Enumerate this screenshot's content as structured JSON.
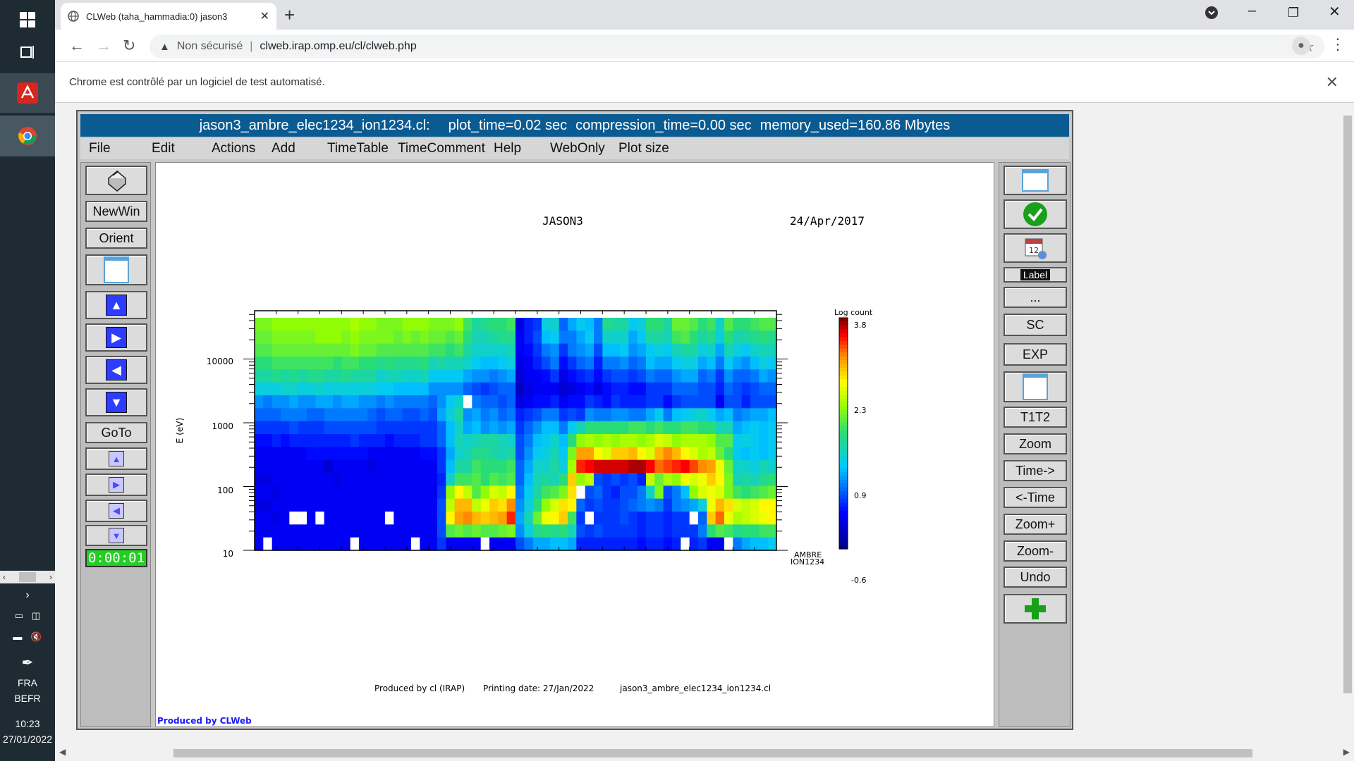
{
  "taskbar": {
    "clock_time": "10:23",
    "clock_date": "27/01/2022",
    "language": "FRA",
    "layout": "BEFR"
  },
  "browser": {
    "tab_title": "CLWeb (taha_hammadia:0) jason3",
    "security_label": "Non sécurisé",
    "url": "clweb.irap.omp.eu/cl/clweb.php",
    "infobar_text": "Chrome est contrôlé par un logiciel de test automatisé."
  },
  "clweb": {
    "title_file": "jason3_ambre_elec1234_ion1234.cl:",
    "title_plot_time": "plot_time=0.02 sec",
    "title_compression": "compression_time=0.00 sec",
    "title_memory": "memory_used=160.86 Mbytes",
    "menu": [
      "File",
      "Edit",
      "Actions",
      "Add",
      "TimeTable",
      "TimeComment",
      "Help",
      "WebOnly",
      "Plot size"
    ],
    "left_buttons": {
      "newwin": "NewWin",
      "orient": "Orient",
      "goto": "GoTo",
      "timer": "0:00:01"
    },
    "right_buttons": {
      "label": "Label",
      "more": "...",
      "sc": "SC",
      "exp": "EXP",
      "t1t2": "T1T2",
      "zoom": "Zoom",
      "time_fwd": "Time->",
      "time_back": "<-Time",
      "zoom_plus": "Zoom+",
      "zoom_minus": "Zoom-",
      "undo": "Undo"
    },
    "footer_left": "Produced by CLWeb"
  },
  "chart_data": {
    "type": "heatmap",
    "title": "JASON3",
    "date": "24/Apr/2017",
    "ylabel": "E (eV)",
    "yscale": "log",
    "yticks": [
      "10000",
      "1000",
      "100",
      "10"
    ],
    "panel_label_1": "AMBRE",
    "panel_label_2": "ION1234",
    "colorbar_title": "Log count",
    "colorbar_ticks": [
      "3.8",
      "2.3",
      "0.9",
      "-0.6"
    ],
    "colorbar_range": [
      -0.6,
      3.8
    ],
    "footer": {
      "produced_by": "Produced by cl (IRAP)",
      "printing_date": "Printing date: 27/Jan/2022",
      "filename": "jason3_ambre_elec1234_ion1234.cl"
    },
    "grid": {
      "cols": 60,
      "rows": 18,
      "note_rows_top_to_bottom": true,
      "values": [
        [
          2.0,
          2.0,
          2.1,
          2.1,
          2.1,
          2.1,
          2.1,
          2.1,
          2.1,
          2.1,
          2.1,
          2.2,
          2.1,
          2.1,
          2.0,
          2.0,
          2.0,
          2.1,
          2.1,
          2.1,
          2.0,
          2.0,
          2.0,
          2.1,
          1.7,
          1.4,
          1.5,
          1.6,
          1.6,
          1.7,
          -0.1,
          0.2,
          0.3,
          1.1,
          1.2,
          0.5,
          0.8,
          1.0,
          0.9,
          0.6,
          1.5,
          1.4,
          1.4,
          1.0,
          1.1,
          1.6,
          1.6,
          1.4,
          1.9,
          1.9,
          1.8,
          1.6,
          1.7,
          1.2,
          1.8,
          1.6,
          1.6,
          1.7,
          1.8,
          1.8
        ],
        [
          1.9,
          1.9,
          2.0,
          2.0,
          2.0,
          2.0,
          2.0,
          2.1,
          2.1,
          2.1,
          2.0,
          2.1,
          2.0,
          2.0,
          2.0,
          2.0,
          1.9,
          2.0,
          1.9,
          2.0,
          1.9,
          1.9,
          1.8,
          1.9,
          1.6,
          1.3,
          1.3,
          1.4,
          1.5,
          1.5,
          0.0,
          0.2,
          0.4,
          0.9,
          1.0,
          0.6,
          0.6,
          0.8,
          1.0,
          0.6,
          1.2,
          1.2,
          1.2,
          0.8,
          1.0,
          1.4,
          1.4,
          1.3,
          1.7,
          1.8,
          1.6,
          1.4,
          1.5,
          1.1,
          1.6,
          1.3,
          1.4,
          1.5,
          1.6,
          1.5
        ],
        [
          1.8,
          1.8,
          1.9,
          1.9,
          1.9,
          1.9,
          1.9,
          1.9,
          1.9,
          1.9,
          1.9,
          2.0,
          1.9,
          1.9,
          1.8,
          1.8,
          1.8,
          1.8,
          1.8,
          1.8,
          1.7,
          1.7,
          1.6,
          1.7,
          1.4,
          1.2,
          1.2,
          1.2,
          1.2,
          1.3,
          0.0,
          0.1,
          0.3,
          0.6,
          0.7,
          0.3,
          0.6,
          0.7,
          0.8,
          0.4,
          0.9,
          0.9,
          1.0,
          0.7,
          0.8,
          1.0,
          1.1,
          1.0,
          1.3,
          1.4,
          1.4,
          1.1,
          1.2,
          0.8,
          1.3,
          1.1,
          1.0,
          1.2,
          1.3,
          1.3
        ],
        [
          1.6,
          1.6,
          1.7,
          1.7,
          1.7,
          1.7,
          1.7,
          1.7,
          1.7,
          1.6,
          1.7,
          1.7,
          1.6,
          1.6,
          1.5,
          1.6,
          1.5,
          1.5,
          1.5,
          1.6,
          1.3,
          1.4,
          1.3,
          1.3,
          1.2,
          1.0,
          0.9,
          0.9,
          1.0,
          1.1,
          -0.1,
          0.0,
          0.2,
          0.4,
          0.6,
          0.1,
          0.3,
          0.5,
          0.6,
          0.2,
          0.6,
          0.6,
          0.7,
          0.5,
          0.6,
          0.9,
          0.8,
          0.8,
          1.0,
          1.1,
          1.1,
          0.8,
          0.9,
          0.6,
          1.0,
          0.8,
          0.7,
          0.9,
          1.1,
          1.0
        ],
        [
          1.4,
          1.4,
          1.5,
          1.4,
          1.5,
          1.4,
          1.5,
          1.5,
          1.4,
          1.4,
          1.5,
          1.4,
          1.4,
          1.4,
          1.2,
          1.3,
          1.3,
          1.2,
          1.2,
          1.3,
          1.0,
          1.0,
          1.0,
          1.0,
          0.8,
          0.7,
          0.7,
          0.6,
          0.7,
          0.8,
          -0.2,
          0.0,
          0.0,
          0.1,
          0.3,
          -0.1,
          0.1,
          0.2,
          0.3,
          0.1,
          0.3,
          0.4,
          0.4,
          0.3,
          0.4,
          0.6,
          0.5,
          0.5,
          0.7,
          0.8,
          0.8,
          0.5,
          0.6,
          0.3,
          0.7,
          0.5,
          0.5,
          0.6,
          0.8,
          0.7
        ],
        [
          1.1,
          1.1,
          1.1,
          1.2,
          1.2,
          1.1,
          1.1,
          1.2,
          1.1,
          1.1,
          1.1,
          1.1,
          1.1,
          1.1,
          1.0,
          1.0,
          0.9,
          0.9,
          0.9,
          0.9,
          0.7,
          0.7,
          0.7,
          0.7,
          0.5,
          0.4,
          0.3,
          0.4,
          0.5,
          0.5,
          -0.3,
          -0.1,
          0.0,
          0.0,
          0.0,
          -0.2,
          -0.1,
          0.0,
          0.1,
          -0.1,
          0.1,
          0.2,
          0.2,
          0.1,
          0.1,
          0.3,
          0.3,
          0.3,
          0.5,
          0.5,
          0.5,
          0.4,
          0.4,
          0.2,
          0.5,
          0.4,
          0.3,
          0.4,
          0.5,
          0.5
        ],
        [
          0.7,
          0.6,
          0.7,
          0.7,
          0.8,
          0.7,
          0.7,
          0.8,
          0.8,
          0.7,
          0.8,
          0.8,
          0.7,
          0.7,
          0.6,
          0.7,
          0.6,
          0.6,
          0.6,
          0.6,
          0.5,
          0.7,
          1.0,
          1.2,
          -0.8,
          0.6,
          0.5,
          0.5,
          0.4,
          0.5,
          -0.1,
          0.0,
          0.1,
          0.1,
          0.2,
          0.0,
          0.1,
          0.1,
          0.3,
          0.2,
          0.1,
          0.3,
          0.2,
          0.2,
          0.2,
          0.3,
          0.3,
          0.1,
          0.3,
          0.4,
          0.4,
          0.4,
          0.4,
          0.0,
          0.4,
          0.4,
          0.2,
          0.4,
          0.4,
          0.4
        ],
        [
          0.5,
          0.5,
          0.5,
          0.6,
          0.6,
          0.6,
          0.5,
          0.5,
          0.6,
          0.6,
          0.6,
          0.6,
          0.6,
          0.5,
          0.4,
          0.5,
          0.5,
          0.4,
          0.4,
          0.5,
          0.4,
          0.8,
          1.1,
          1.4,
          0.7,
          0.8,
          0.6,
          0.7,
          0.5,
          0.6,
          0.2,
          0.3,
          0.4,
          0.6,
          0.6,
          0.3,
          0.4,
          0.3,
          0.7,
          0.6,
          0.6,
          0.7,
          0.7,
          0.6,
          0.6,
          0.8,
          1.0,
          0.6,
          0.9,
          1.0,
          1.1,
          1.2,
          1.0,
          0.8,
          0.9,
          0.6,
          0.7,
          0.8,
          0.8,
          0.9
        ],
        [
          0.3,
          0.3,
          0.3,
          0.3,
          0.4,
          0.3,
          0.3,
          0.3,
          0.4,
          0.4,
          0.4,
          0.4,
          0.4,
          0.4,
          0.3,
          0.3,
          0.3,
          0.3,
          0.3,
          0.3,
          0.3,
          0.5,
          0.9,
          1.2,
          0.8,
          0.9,
          0.7,
          0.8,
          0.7,
          0.8,
          0.3,
          0.5,
          0.7,
          0.9,
          0.9,
          0.6,
          1.0,
          1.3,
          1.6,
          1.6,
          1.6,
          1.6,
          1.6,
          1.7,
          1.7,
          1.6,
          1.7,
          1.6,
          1.6,
          1.7,
          1.7,
          1.6,
          1.6,
          1.3,
          1.3,
          0.8,
          0.9,
          1.0,
          0.9,
          1.0
        ],
        [
          0.1,
          0.1,
          0.2,
          0.1,
          0.2,
          0.2,
          0.2,
          0.2,
          0.2,
          0.2,
          0.2,
          0.3,
          0.2,
          0.2,
          0.2,
          0.1,
          0.2,
          0.2,
          0.2,
          0.3,
          0.3,
          0.5,
          0.9,
          1.3,
          1.2,
          1.3,
          1.4,
          1.4,
          1.3,
          1.2,
          0.4,
          0.6,
          0.9,
          1.0,
          1.2,
          0.9,
          1.6,
          2.1,
          2.2,
          2.1,
          2.2,
          2.1,
          2.2,
          2.2,
          2.1,
          2.2,
          2.4,
          2.3,
          2.1,
          2.2,
          2.2,
          2.2,
          2.1,
          1.8,
          1.8,
          1.0,
          1.1,
          1.0,
          0.9,
          1.0
        ],
        [
          0.0,
          0.0,
          0.0,
          0.0,
          0.0,
          0.0,
          0.1,
          0.1,
          0.1,
          0.1,
          0.1,
          0.1,
          0.1,
          0.0,
          0.0,
          0.0,
          0.0,
          0.0,
          0.0,
          0.1,
          0.1,
          0.3,
          0.8,
          1.2,
          1.3,
          1.5,
          1.5,
          1.4,
          1.3,
          1.4,
          0.4,
          0.7,
          1.0,
          1.1,
          1.3,
          1.0,
          2.0,
          3.0,
          3.0,
          2.6,
          2.4,
          2.8,
          2.8,
          2.9,
          2.6,
          2.4,
          2.9,
          3.1,
          2.9,
          2.6,
          2.4,
          2.2,
          2.3,
          1.9,
          1.6,
          1.0,
          0.9,
          1.0,
          0.9,
          1.0
        ],
        [
          0.0,
          0.0,
          0.0,
          0.0,
          0.0,
          0.0,
          0.0,
          0.0,
          -0.2,
          0.0,
          0.0,
          0.0,
          0.0,
          -0.1,
          0.0,
          0.0,
          0.0,
          0.0,
          0.0,
          0.0,
          0.0,
          0.3,
          0.9,
          1.4,
          1.4,
          1.7,
          1.6,
          1.6,
          1.6,
          1.7,
          0.5,
          0.8,
          1.2,
          1.2,
          1.4,
          1.1,
          2.2,
          3.4,
          3.5,
          3.6,
          3.6,
          3.6,
          3.6,
          3.7,
          3.7,
          3.5,
          3.2,
          3.3,
          3.4,
          3.5,
          3.3,
          3.1,
          3.0,
          2.5,
          1.9,
          1.2,
          1.2,
          1.1,
          1.3,
          1.2
        ],
        [
          -0.1,
          -0.1,
          0.0,
          0.0,
          0.0,
          0.0,
          0.0,
          0.0,
          0.0,
          -0.1,
          0.0,
          0.0,
          0.0,
          0.0,
          0.0,
          0.0,
          0.0,
          0.0,
          0.0,
          0.0,
          0.0,
          0.2,
          1.2,
          1.7,
          1.7,
          1.8,
          1.6,
          1.8,
          1.7,
          1.8,
          0.5,
          0.9,
          1.3,
          1.4,
          1.3,
          1.6,
          2.8,
          2.1,
          2.3,
          0.4,
          0.3,
          0.4,
          0.3,
          0.4,
          0.2,
          2.3,
          1.9,
          2.2,
          2.1,
          2.5,
          2.4,
          2.5,
          2.8,
          2.6,
          2.0,
          1.3,
          1.4,
          1.3,
          1.5,
          1.6
        ],
        [
          0.0,
          0.0,
          -0.1,
          0.0,
          0.0,
          0.0,
          0.0,
          0.0,
          0.0,
          0.0,
          0.0,
          0.0,
          0.0,
          0.0,
          0.0,
          0.0,
          0.0,
          0.0,
          0.0,
          0.0,
          0.0,
          0.3,
          2.1,
          2.6,
          2.3,
          1.8,
          2.1,
          2.4,
          2.3,
          2.6,
          0.6,
          1.0,
          1.4,
          1.7,
          1.8,
          2.0,
          2.7,
          -0.8,
          0.4,
          0.5,
          0.3,
          0.2,
          0.4,
          0.4,
          0.6,
          1.2,
          2.0,
          0.4,
          0.6,
          0.9,
          2.1,
          2.4,
          2.5,
          2.4,
          2.0,
          1.7,
          1.6,
          1.7,
          1.8,
          1.9
        ],
        [
          -0.1,
          -0.1,
          0.0,
          0.0,
          0.0,
          0.0,
          0.0,
          0.0,
          0.0,
          0.0,
          0.0,
          0.0,
          0.0,
          0.0,
          0.0,
          0.0,
          0.0,
          0.0,
          0.0,
          0.0,
          0.0,
          0.4,
          2.3,
          2.9,
          2.9,
          2.3,
          2.5,
          2.8,
          2.7,
          3.1,
          0.7,
          1.1,
          1.6,
          2.1,
          2.4,
          2.7,
          2.6,
          0.5,
          0.3,
          0.4,
          0.3,
          0.3,
          0.4,
          0.5,
          0.6,
          0.7,
          0.6,
          0.3,
          0.6,
          0.7,
          0.8,
          1.1,
          2.5,
          2.9,
          2.7,
          2.4,
          2.3,
          2.4,
          2.6,
          2.6
        ],
        [
          0.0,
          0.0,
          -0.1,
          0.0,
          -0.8,
          -0.8,
          0.0,
          -0.8,
          0.0,
          0.0,
          0.0,
          0.0,
          0.0,
          0.0,
          0.0,
          -0.8,
          0.0,
          0.0,
          0.0,
          0.0,
          0.0,
          0.4,
          2.6,
          3.0,
          3.1,
          2.9,
          2.8,
          2.9,
          3.0,
          3.4,
          0.8,
          1.3,
          1.9,
          2.5,
          2.6,
          2.8,
          1.7,
          0.3,
          -0.8,
          0.3,
          0.3,
          0.3,
          0.4,
          0.3,
          0.2,
          0.3,
          0.3,
          0.2,
          0.3,
          0.3,
          -0.8,
          0.5,
          2.8,
          3.2,
          2.5,
          2.2,
          2.3,
          2.4,
          2.5,
          2.6
        ],
        [
          0.0,
          0.0,
          0.0,
          0.0,
          0.0,
          0.0,
          0.0,
          0.0,
          0.0,
          0.0,
          0.0,
          0.0,
          0.0,
          0.0,
          0.0,
          0.0,
          0.0,
          0.0,
          0.0,
          0.0,
          0.0,
          0.4,
          1.8,
          1.9,
          1.8,
          1.9,
          1.8,
          1.8,
          1.9,
          2.0,
          0.7,
          1.1,
          1.5,
          1.6,
          1.5,
          1.6,
          1.3,
          0.4,
          0.3,
          0.4,
          0.3,
          0.3,
          0.3,
          0.3,
          0.2,
          0.3,
          0.3,
          0.2,
          0.3,
          0.3,
          0.3,
          0.6,
          1.6,
          1.8,
          1.7,
          1.5,
          1.6,
          1.6,
          1.7,
          1.7
        ],
        [
          0.0,
          -0.8,
          0.0,
          0.0,
          0.0,
          0.0,
          0.0,
          0.0,
          0.0,
          0.0,
          0.0,
          -0.8,
          0.0,
          0.0,
          0.0,
          0.0,
          0.0,
          0.0,
          -0.8,
          0.0,
          0.0,
          0.3,
          0.0,
          0.0,
          0.0,
          0.0,
          -0.8,
          0.0,
          0.0,
          0.0,
          0.4,
          0.6,
          0.8,
          0.8,
          0.9,
          0.9,
          0.8,
          0.2,
          0.2,
          0.2,
          0.2,
          0.2,
          0.2,
          0.2,
          0.1,
          0.2,
          0.2,
          0.1,
          0.2,
          -0.8,
          0.2,
          0.3,
          0.0,
          0.0,
          -0.8,
          0.6,
          0.8,
          0.9,
          0.9,
          1.0
        ]
      ]
    }
  }
}
